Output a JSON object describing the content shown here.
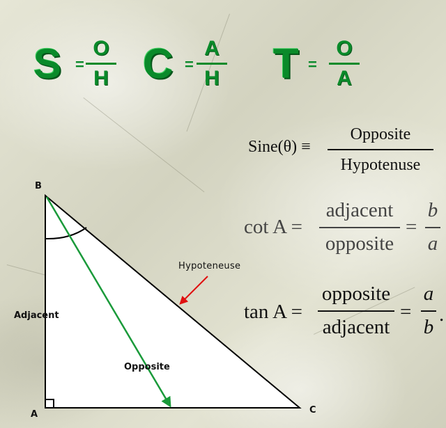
{
  "mnemonic": {
    "sine": {
      "letter": "S",
      "equals": "=",
      "top": "O",
      "bottom": "H"
    },
    "cosine": {
      "letter": "C",
      "equals": "=",
      "top": "A",
      "bottom": "H"
    },
    "tangent": {
      "letter": "T",
      "equals": "=",
      "top": "O",
      "bottom": "A"
    }
  },
  "formulas": {
    "sine": {
      "lhs": "Sine(θ) ≡",
      "numerator": "Opposite",
      "denominator": "Hypotenuse"
    },
    "cot": {
      "lhs": "cot A =",
      "numerator": "adjacent",
      "denominator": "opposite",
      "equals2": "=",
      "num2": "b",
      "den2": "a"
    },
    "tan": {
      "lhs": "tan A =",
      "numerator": "opposite",
      "denominator": "adjacent",
      "equals2": "=",
      "num2": "a",
      "den2": "b",
      "trail": "."
    }
  },
  "triangle": {
    "vertex_a": "A",
    "vertex_b": "B",
    "vertex_c": "C",
    "side_adjacent": "Adjacent",
    "side_opposite": "Opposite",
    "side_hypotenuse": "Hypoteneuse",
    "colors": {
      "fill": "#ffffff",
      "stroke": "#000000",
      "green_arrow": "#1a9a3a",
      "red_arrow": "#e01010"
    }
  }
}
